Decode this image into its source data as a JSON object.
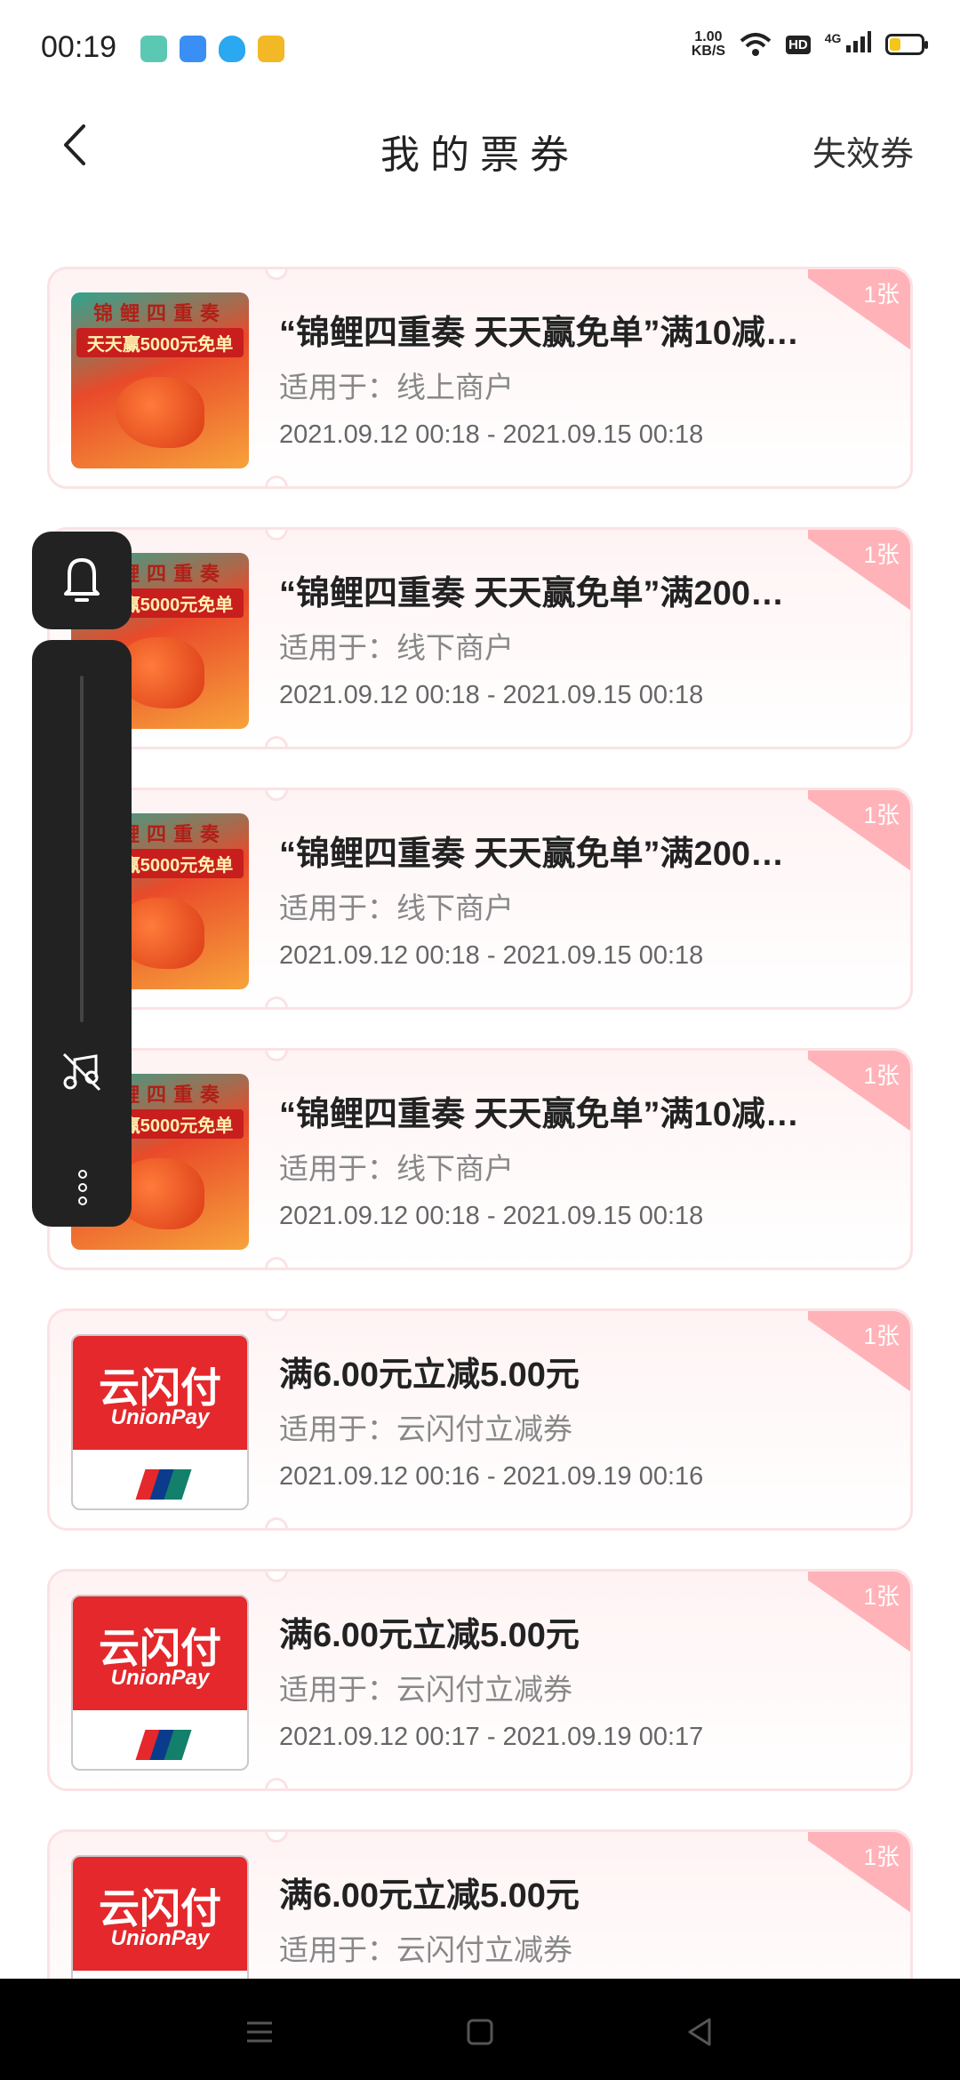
{
  "status_bar": {
    "time": "00:19",
    "net_speed_value": "1.00",
    "net_speed_unit": "KB/S",
    "hd": "HD",
    "network": "4G",
    "app_icon_colors": [
      "#5bc8b4",
      "#3a8ff5",
      "#2aa8f0",
      "#f3b825"
    ]
  },
  "header": {
    "title": "我的票券",
    "expired_label": "失效券"
  },
  "coupons": [
    {
      "title": "“锦鲤四重奏 天天赢免单”满10减…",
      "scope": "适用于：线上商户",
      "date": "2021.09.12 00:18 - 2021.09.15 00:18",
      "count": "1张",
      "image": "koi-promo"
    },
    {
      "title": "“锦鲤四重奏 天天赢免单”满200…",
      "scope": "适用于：线下商户",
      "date": "2021.09.12 00:18 - 2021.09.15 00:18",
      "count": "1张",
      "image": "koi-promo"
    },
    {
      "title": "“锦鲤四重奏 天天赢免单”满200…",
      "scope": "适用于：线下商户",
      "date": "2021.09.12 00:18 - 2021.09.15 00:18",
      "count": "1张",
      "image": "koi-promo"
    },
    {
      "title": "“锦鲤四重奏 天天赢免单”满10减…",
      "scope": "适用于：线下商户",
      "date": "2021.09.12 00:18 - 2021.09.15 00:18",
      "count": "1张",
      "image": "koi-promo"
    },
    {
      "title": "满6.00元立减5.00元",
      "scope": "适用于：云闪付立减券",
      "date": "2021.09.12 00:16 - 2021.09.19 00:16",
      "count": "1张",
      "image": "unionpay"
    },
    {
      "title": "满6.00元立减5.00元",
      "scope": "适用于：云闪付立减券",
      "date": "2021.09.12 00:17 - 2021.09.19 00:17",
      "count": "1张",
      "image": "unionpay"
    },
    {
      "title": "满6.00元立减5.00元",
      "scope": "适用于：云闪付立减券",
      "date": "",
      "count": "1张",
      "image": "unionpay"
    }
  ],
  "koi_image_text": {
    "line1": "锦鲤四重奏",
    "line2": "天天赢5000元免单"
  },
  "unionpay_image_text": {
    "brand_cn": "云闪付",
    "brand_en": "UnionPay"
  },
  "colors": {
    "accent_badge": "#ffb3b8",
    "card_border": "#fbe2e4",
    "unionpay_red": "#e4282c"
  }
}
